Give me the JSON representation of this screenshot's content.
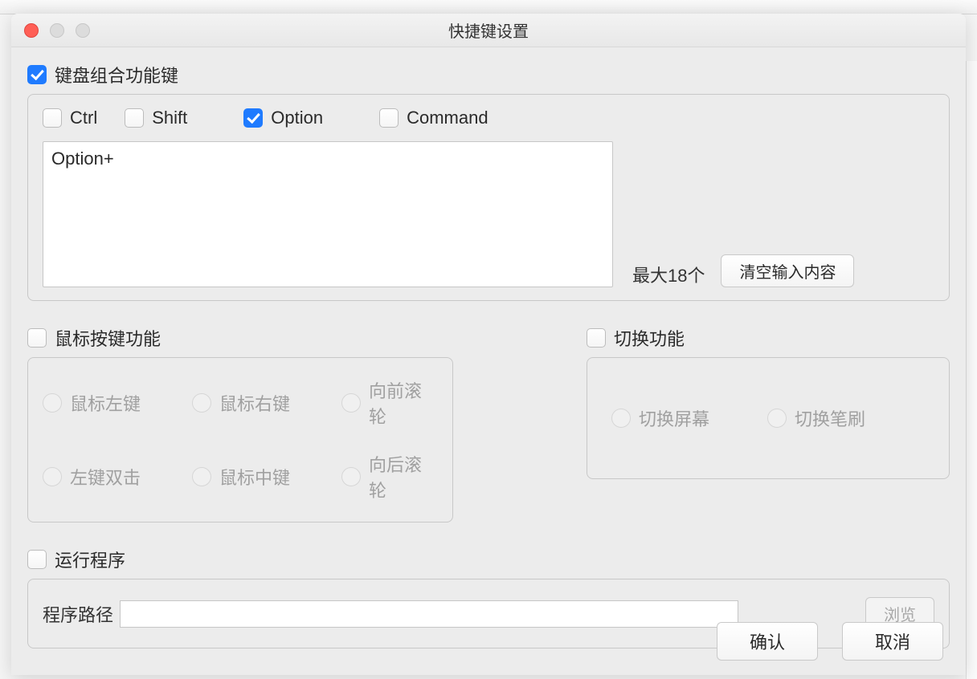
{
  "window": {
    "title": "快捷键设置"
  },
  "keyboard_section": {
    "header": "键盘组合功能键",
    "enabled": true,
    "modifiers": {
      "ctrl": {
        "label": "Ctrl",
        "checked": false
      },
      "shift": {
        "label": "Shift",
        "checked": false
      },
      "option": {
        "label": "Option",
        "checked": true
      },
      "command": {
        "label": "Command",
        "checked": false
      }
    },
    "input_value": "Option+",
    "max_label": "最大18个",
    "clear_button": "清空输入内容"
  },
  "mouse_section": {
    "header": "鼠标按键功能",
    "enabled": false,
    "options": {
      "left": "鼠标左键",
      "right": "鼠标右键",
      "scroll_fwd": "向前滚轮",
      "dbl_left": "左键双击",
      "middle": "鼠标中键",
      "scroll_back": "向后滚轮"
    }
  },
  "switch_section": {
    "header": "切换功能",
    "enabled": false,
    "options": {
      "screen": "切换屏幕",
      "brush": "切换笔刷"
    }
  },
  "run_section": {
    "header": "运行程序",
    "enabled": false,
    "path_label": "程序路径",
    "path_value": "",
    "browse_button": "浏览"
  },
  "footer": {
    "ok": "确认",
    "cancel": "取消"
  }
}
